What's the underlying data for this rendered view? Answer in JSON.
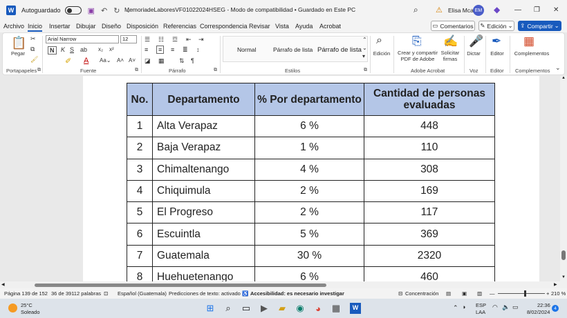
{
  "titlebar": {
    "app_icon": "W",
    "autosave": "Autoguardado",
    "doc_title": "MemoriadeLaboresVF01022024HSEG  -  Modo de compatibilidad  •  Guardado en Este PC",
    "user": "Elisa Mcal",
    "avatar": "EM"
  },
  "menu": {
    "items": [
      "Archivo",
      "Inicio",
      "Insertar",
      "Dibujar",
      "Diseño",
      "Disposición",
      "Referencias",
      "Correspondencia",
      "Revisar",
      "Vista",
      "Ayuda",
      "Acrobat"
    ],
    "comments": "Comentarios",
    "edit": "Edición",
    "share": "Compartir"
  },
  "ribbon": {
    "paste": "Pegar",
    "font": "Arial Narrow",
    "size": "12",
    "styles": [
      "Normal",
      "Párrafo de lista",
      "Párrafo de lista"
    ],
    "edition": "Edición",
    "create_pdf": "Crear y compartir\nPDF de Adobe",
    "sign": "Solicitar\nfirmas",
    "dictate": "Dictar",
    "editor": "Editor",
    "complements": "Complementos",
    "groups": [
      "Portapapeles",
      "Fuente",
      "Párrafo",
      "Estilos",
      "Adobe Acrobat",
      "Voz",
      "Editor",
      "Complementos"
    ]
  },
  "table": {
    "headers": [
      "No.",
      "Departamento",
      "% Por departamento",
      "Cantidad de personas evaluadas"
    ],
    "rows": [
      [
        "1",
        "Alta Verapaz",
        "6 %",
        "448"
      ],
      [
        "2",
        "Baja Verapaz",
        "1 %",
        "110"
      ],
      [
        "3",
        "Chimaltenango",
        "4 %",
        "308"
      ],
      [
        "4",
        "Chiquimula",
        "2 %",
        "169"
      ],
      [
        "5",
        "El Progreso",
        "2 %",
        "117"
      ],
      [
        "6",
        "Escuintla",
        "5 %",
        "369"
      ],
      [
        "7",
        "Guatemala",
        "30 %",
        "2320"
      ],
      [
        "8",
        "Huehuetenango",
        "6 %",
        "460"
      ]
    ]
  },
  "status": {
    "page": "Página 139 de 152",
    "words": "36 de 39112 palabras",
    "language": "Español (Guatemala)",
    "prediction": "Predicciones de texto: activado",
    "accessibility": "Accesibilidad: es necesario investigar",
    "focus": "Concentración",
    "zoom": "210 %"
  },
  "taskbar": {
    "temp": "25°C",
    "weather": "Soleado",
    "lang1": "ESP",
    "lang2": "LAA",
    "time": "22:36",
    "date": "8/02/2024",
    "badge": "4"
  }
}
